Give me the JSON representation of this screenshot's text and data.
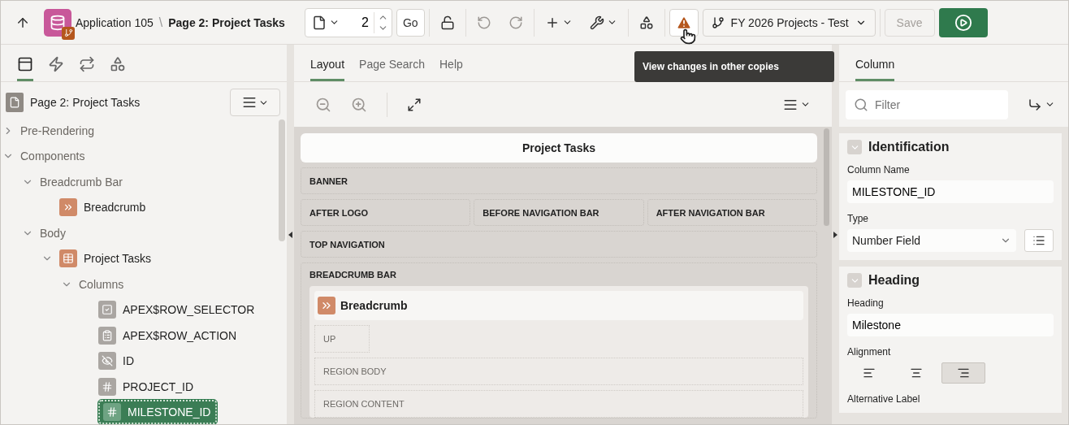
{
  "header": {
    "app": "Application 105",
    "separator": "\\",
    "page": "Page 2: Project Tasks",
    "page_number": "2",
    "go": "Go",
    "branch": "FY 2026 Projects - Test",
    "save": {
      "label": "Save",
      "disabled": true
    },
    "tooltip": "View changes in other copies"
  },
  "left_tabs": [
    {
      "kind": "rendering",
      "selected": true
    },
    {
      "kind": "dynamic",
      "selected": false
    },
    {
      "kind": "processing",
      "selected": false
    },
    {
      "kind": "shared",
      "selected": false
    }
  ],
  "tree": {
    "title": "Page 2: Project Tasks",
    "nodes": [
      {
        "label": "Pre-Rendering",
        "kind": "folder",
        "expanded": false
      },
      {
        "label": "Components",
        "kind": "folder",
        "expanded": true,
        "children": [
          {
            "label": "Breadcrumb Bar",
            "kind": "folder",
            "expanded": true,
            "children": [
              {
                "label": "Breadcrumb",
                "kind": "breadcrumb",
                "selected": false
              }
            ]
          },
          {
            "label": "Body",
            "kind": "folder",
            "expanded": true,
            "children": [
              {
                "label": "Project Tasks",
                "kind": "region",
                "expanded": true,
                "children": [
                  {
                    "label": "Columns",
                    "kind": "folder",
                    "expanded": true,
                    "children": [
                      {
                        "label": "APEX$ROW_SELECTOR",
                        "kind": "checkbox",
                        "selected": false
                      },
                      {
                        "label": "APEX$ROW_ACTION",
                        "kind": "action",
                        "selected": false
                      },
                      {
                        "label": "ID",
                        "kind": "hidden",
                        "selected": false
                      },
                      {
                        "label": "PROJECT_ID",
                        "kind": "number",
                        "selected": false
                      },
                      {
                        "label": "MILESTONE_ID",
                        "kind": "number",
                        "selected": true
                      }
                    ]
                  }
                ]
              }
            ]
          }
        ]
      }
    ]
  },
  "center": {
    "tabs": [
      {
        "label": "Layout",
        "selected": true
      },
      {
        "label": "Page Search",
        "selected": false
      },
      {
        "label": "Help",
        "selected": false
      }
    ],
    "page_title": "Project Tasks",
    "rows": [
      [
        "BANNER"
      ],
      [
        "AFTER LOGO",
        "BEFORE NAVIGATION BAR",
        "AFTER NAVIGATION BAR"
      ],
      [
        "TOP NAVIGATION"
      ]
    ],
    "breadcrumb_bar": {
      "label": "BREADCRUMB BAR",
      "region": "Breadcrumb",
      "slots": [
        "UP",
        "REGION BODY",
        "REGION CONTENT"
      ]
    }
  },
  "right": {
    "tab": "Column",
    "filter_placeholder": "Filter",
    "groups": [
      {
        "title": "Identification",
        "expanded": true,
        "fields": [
          {
            "kind": "text",
            "label": "Column Name",
            "value": "MILESTONE_ID"
          },
          {
            "kind": "select",
            "label": "Type",
            "value": "Number Field"
          }
        ]
      },
      {
        "title": "Heading",
        "expanded": true,
        "fields": [
          {
            "kind": "text",
            "label": "Heading",
            "value": "Milestone"
          },
          {
            "kind": "alignment",
            "label": "Alignment",
            "options": [
              {
                "kind": "left",
                "selected": false
              },
              {
                "kind": "center",
                "selected": false
              },
              {
                "kind": "right",
                "selected": true
              }
            ]
          },
          {
            "kind": "label",
            "label": "Alternative Label"
          }
        ]
      }
    ]
  }
}
